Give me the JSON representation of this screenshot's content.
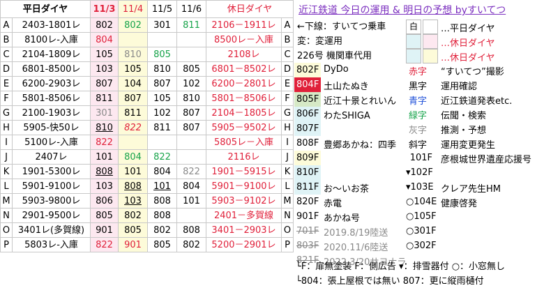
{
  "header": {
    "code_col": "平日ダイヤ",
    "dates": [
      "11/3",
      "11/4",
      "11/5",
      "11/6"
    ],
    "holiday_col": "休日ダイヤ"
  },
  "rows": [
    {
      "key": "A",
      "weekday": "2403-1801レ",
      "d": [
        "802",
        "802",
        "301",
        "811"
      ],
      "holiday": "2106－1911レ",
      "key2": "A"
    },
    {
      "key": "B",
      "weekday": "8100レ-入庫",
      "d": [
        "804",
        "",
        "",
        ""
      ],
      "holiday": "8500レ－入庫",
      "key2": "B"
    },
    {
      "key": "C",
      "weekday": "2104-1809レ",
      "d": [
        "105",
        "810",
        "805",
        ""
      ],
      "holiday": "2108レ",
      "key2": "C"
    },
    {
      "key": "D",
      "weekday": "6801-8500レ",
      "d": [
        "103",
        "105",
        "810",
        "805"
      ],
      "holiday": "6801－8502レ",
      "key2": "D"
    },
    {
      "key": "E",
      "weekday": "6200-2903レ",
      "d": [
        "807",
        "104",
        "807",
        "102"
      ],
      "holiday": "6200－2801レ",
      "key2": "E"
    },
    {
      "key": "F",
      "weekday": "5801-8506レ",
      "d": [
        "811",
        "807",
        "105",
        "810"
      ],
      "holiday": "5801－8506レ",
      "key2": "F"
    },
    {
      "key": "G",
      "weekday": "2100-1903レ",
      "d": [
        "301",
        "811",
        "102",
        "807"
      ],
      "holiday": "2104－1805レ",
      "key2": "G"
    },
    {
      "key": "H",
      "weekday": "5905-快50レ",
      "d": [
        "810",
        "822",
        "811",
        "807"
      ],
      "holiday": "5905－9502レ",
      "key2": "H"
    },
    {
      "key": "I",
      "weekday": "5100レ-入庫",
      "d": [
        "822",
        "",
        "",
        ""
      ],
      "holiday": "5805レ－入庫",
      "key2": "I"
    },
    {
      "key": "J",
      "weekday": "2407レ",
      "d": [
        "101",
        "804",
        "822",
        ""
      ],
      "holiday": "2116レ",
      "key2": "J"
    },
    {
      "key": "K",
      "weekday": "1901-5300レ",
      "d": [
        "808",
        "101",
        "804",
        "822"
      ],
      "holiday": "1901－5915レ",
      "key2": "K"
    },
    {
      "key": "L",
      "weekday": "5901-9100レ",
      "d": [
        "103",
        "808",
        "101",
        "804"
      ],
      "holiday": "5901－9100レ",
      "key2": "L"
    },
    {
      "key": "M",
      "weekday": "5903-9800レ",
      "d": [
        "806",
        "103",
        "808",
        "101"
      ],
      "holiday": "5903－9102レ",
      "key2": "M"
    },
    {
      "key": "N",
      "weekday": "2901-9500レ",
      "d": [
        "805",
        "802",
        "808",
        ""
      ],
      "holiday": "2401－多賀線",
      "key2": "N"
    },
    {
      "key": "O",
      "weekday": "3401レ(多賀線)",
      "d": [
        "901",
        "805",
        "802",
        "808"
      ],
      "holiday": "3401－2903レ",
      "key2": "O"
    },
    {
      "key": "P",
      "weekday": "5803レ-入庫",
      "d": [
        "822",
        "901",
        "805",
        "802"
      ],
      "holiday": "5200－2901レ",
      "key2": "P"
    }
  ],
  "panel": {
    "title": "近江鉄道 今日の運用 & 明日の予想 byすいてつ",
    "legend": {
      "underline_label": "←下線：すいてつ乗車",
      "hen_label": "変：変運用",
      "k226_label": "226号 機関車代用",
      "white_box": "白",
      "weekday": "…平日ダイヤ",
      "holiday1": "…休日ダイヤ",
      "holiday2": "…休日ダイヤ"
    },
    "fleet_left": [
      {
        "id": "802F",
        "name": "DyDo"
      },
      {
        "id": "804F",
        "name": "土山たぬき"
      },
      {
        "id": "805F",
        "name": "近江十景とれいん"
      },
      {
        "id": "806F",
        "name": "わたSHIGA"
      },
      {
        "id": "807F",
        "name": ""
      },
      {
        "id": "808F",
        "name": "豊郷あかね：四季"
      },
      {
        "id": "809F",
        "name": ""
      },
      {
        "id": "810F",
        "name": ""
      },
      {
        "id": "811F",
        "name": "お～いお茶"
      },
      {
        "id": "820F",
        "name": "赤電"
      },
      {
        "id": "901F",
        "name": "あかね号"
      },
      {
        "id": "701F",
        "name": "2019.8/19陸送"
      },
      {
        "id": "803F",
        "name": "2020.11/6陸送"
      },
      {
        "id": "821F",
        "name": "2022.3/20サヨナラ"
      }
    ],
    "fleet_right": [
      {
        "id": "",
        "label": ""
      },
      {
        "id": "",
        "label": ""
      },
      {
        "id": "",
        "label": ""
      },
      {
        "id": "",
        "label": ""
      },
      {
        "id": "",
        "label": ""
      },
      {
        "id": "",
        "label": ""
      },
      {
        "id": "101F",
        "label": "彦根城世界遺産応援号"
      },
      {
        "id": "▾102F",
        "label": ""
      },
      {
        "id": "▾103E",
        "label": "クレア先生HM"
      },
      {
        "id": "○104E",
        "label": "健康啓発"
      },
      {
        "id": "○105F",
        "label": ""
      },
      {
        "id": "○301F",
        "label": ""
      },
      {
        "id": "○302F",
        "label": ""
      }
    ],
    "colors_legend": [
      {
        "word": "赤字",
        "desc": "“すいてつ”撮影"
      },
      {
        "word": "黒字",
        "desc": "運用確認"
      },
      {
        "word": "青字",
        "desc": "近江鉄道発表etc."
      },
      {
        "word": "緑字",
        "desc": "伝聞・検索"
      },
      {
        "word": "灰字",
        "desc": "推測・予想"
      },
      {
        "word": "斜字",
        "desc": "運用変更発生"
      }
    ],
    "footer1": "└F：扉無塗装  F：側広告  ▾：排雪器付  ○：小窓無し",
    "footer2": "└804：張上屋根では無い  807：更に縦雨樋付"
  },
  "colors": {
    "holiday_red": "#e0203a",
    "title_purple": "#7b2fbf",
    "green": "#16a34a",
    "gray": "#8a8a8a",
    "pink_col": "#fde8f0",
    "yellow_col": "#fdfbd9"
  }
}
